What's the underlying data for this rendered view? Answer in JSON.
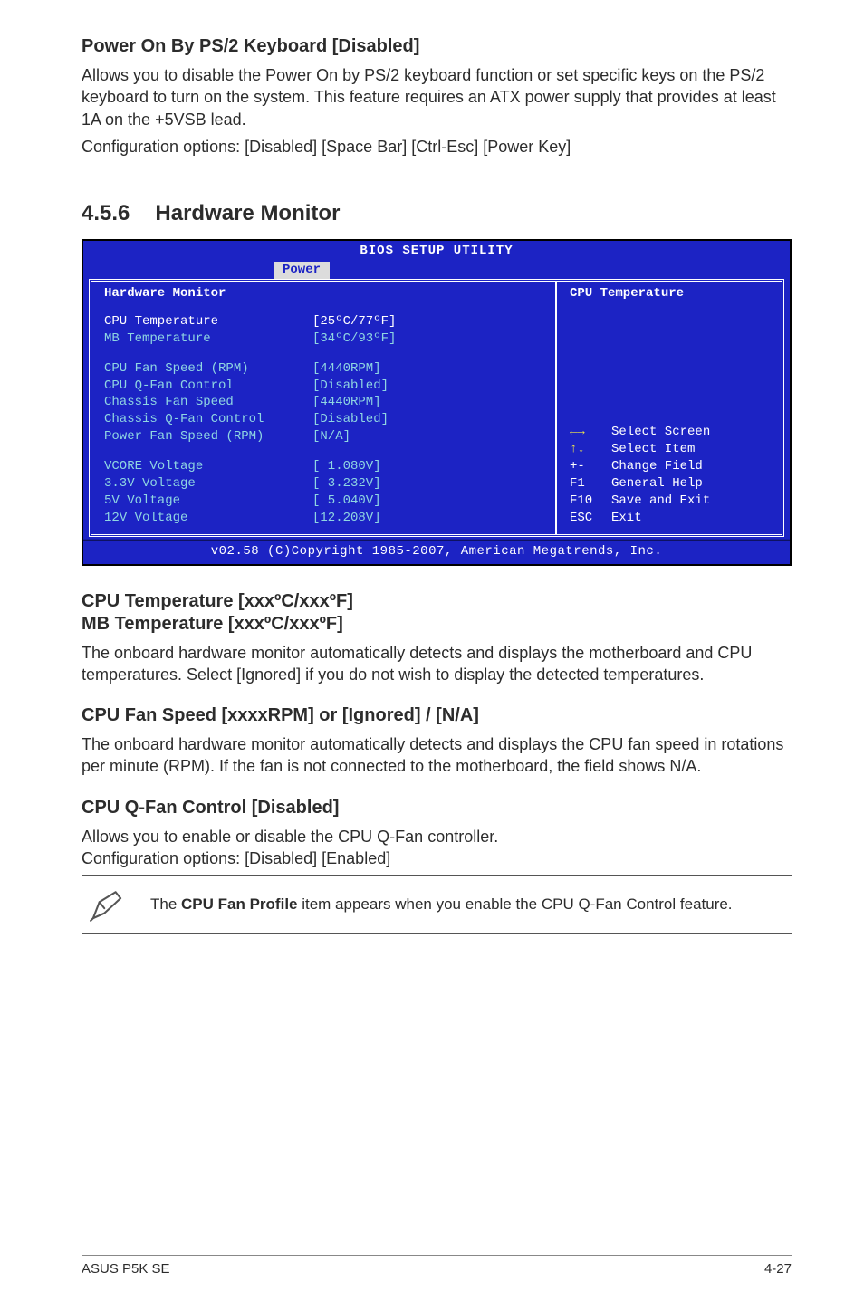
{
  "s1": {
    "heading": "Power On By PS/2 Keyboard [Disabled]",
    "p1": "Allows you to disable the Power On by PS/2 keyboard function or set specific keys on the PS/2 keyboard to turn on the system. This feature requires an ATX power supply that provides at least 1A on the +5VSB lead.",
    "p2": "Configuration options: [Disabled] [Space Bar] [Ctrl-Esc] [Power Key]"
  },
  "secnum": "4.5.6",
  "sectitle": "Hardware Monitor",
  "bios": {
    "title": "BIOS SETUP UTILITY",
    "tab": "Power",
    "left_heading": "Hardware Monitor",
    "rows": [
      {
        "l": "CPU Temperature",
        "v": "[25ºC/77ºF]",
        "cls": "bios-white-row"
      },
      {
        "l": "MB Temperature",
        "v": "[34ºC/93ºF]"
      },
      {
        "l": "",
        "v": ""
      },
      {
        "l": "CPU Fan Speed (RPM)",
        "v": "[4440RPM]"
      },
      {
        "l": "CPU Q-Fan Control",
        "v": "[Disabled]"
      },
      {
        "l": "Chassis Fan Speed",
        "v": "[4440RPM]"
      },
      {
        "l": "Chassis Q-Fan Control",
        "v": "[Disabled]"
      },
      {
        "l": "Power Fan Speed (RPM)",
        "v": "[N/A]"
      },
      {
        "l": "",
        "v": ""
      },
      {
        "l": "VCORE Voltage",
        "v": "[ 1.080V]"
      },
      {
        "l": "3.3V Voltage",
        "v": "[ 3.232V]"
      },
      {
        "l": "5V Voltage",
        "v": "[ 5.040V]"
      },
      {
        "l": "12V Voltage",
        "v": "[12.208V]"
      }
    ],
    "hint": "CPU Temperature",
    "nav": [
      {
        "k": "←→",
        "t": "Select Screen",
        "ky": true
      },
      {
        "k": "↑↓",
        "t": "Select Item",
        "ky": true
      },
      {
        "k": "+-",
        "t": "Change Field"
      },
      {
        "k": "F1",
        "t": "General Help"
      },
      {
        "k": "F10",
        "t": "Save and Exit"
      },
      {
        "k": "ESC",
        "t": "Exit"
      }
    ],
    "foot": "v02.58 (C)Copyright 1985-2007, American Megatrends, Inc."
  },
  "s2": {
    "h1": "CPU Temperature [xxxºC/xxxºF]",
    "h2": "MB Temperature [xxxºC/xxxºF]",
    "p": "The onboard hardware monitor automatically detects and displays the motherboard and CPU temperatures. Select [Ignored] if you do not wish to display the detected temperatures."
  },
  "s3": {
    "h": "CPU Fan Speed [xxxxRPM] or [Ignored] / [N/A]",
    "p": "The onboard hardware monitor automatically detects and displays the CPU fan speed in rotations per minute (RPM). If the fan is not connected to the motherboard, the field shows N/A."
  },
  "s4": {
    "h": "CPU Q-Fan Control [Disabled]",
    "p1": "Allows you to enable or disable the CPU Q-Fan controller.",
    "p2": "Configuration options: [Disabled] [Enabled]"
  },
  "note": {
    "pre": "The ",
    "bold": "CPU Fan Profile",
    "post": " item appears when you enable the CPU Q-Fan Control feature."
  },
  "footer": {
    "left": "ASUS P5K SE",
    "right": "4-27"
  }
}
